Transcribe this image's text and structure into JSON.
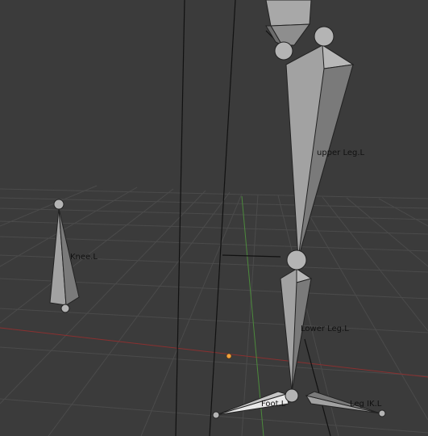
{
  "viewport": {
    "background": "#3b3b3b",
    "grid_color": "#4a4a4a",
    "x_axis_color": "#8a3030",
    "y_axis_color": "#4c8a3c"
  },
  "bones": {
    "upper_leg": "upper Leg.L",
    "lower_leg": "Lower Leg.L",
    "knee": "Knee.L",
    "foot": "Foot.L",
    "leg_ik": "Leg IK.L"
  },
  "colors": {
    "bone_light": "#a8a8a8",
    "bone_mid": "#8e8e8e",
    "bone_dark": "#6c6c6c",
    "bone_selected": "#e8e8e8",
    "origin": "#f2a23c"
  }
}
